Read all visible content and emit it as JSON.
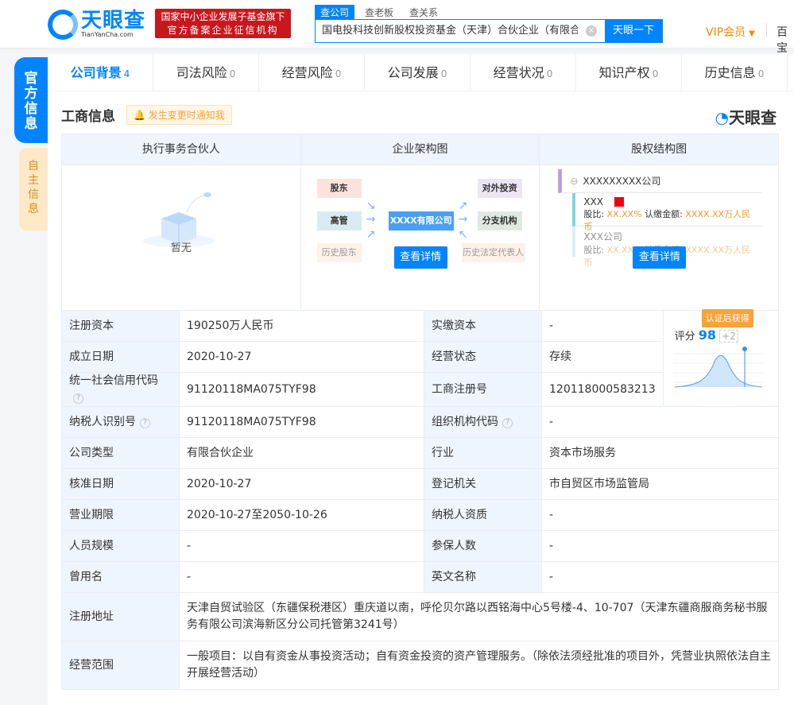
{
  "header": {
    "logo_cn": "天眼查",
    "logo_en": "TianYanCha.com",
    "badge_line1": "国家中小企业发展子基金旗下",
    "badge_line2": "官方备案企业征信机构",
    "search_tabs": [
      "查公司",
      "查老板",
      "查关系"
    ],
    "search_value": "国电投科技创新股权投资基金（天津）合伙企业（有限合伙）",
    "search_button": "天眼一下",
    "vip": "VIP会员",
    "more": "百宝"
  },
  "side": {
    "official": "官方信息",
    "self": "自主信息"
  },
  "tabs": [
    {
      "label": "公司背景",
      "count": "4"
    },
    {
      "label": "司法风险",
      "count": "0"
    },
    {
      "label": "经营风险",
      "count": "0"
    },
    {
      "label": "公司发展",
      "count": "0"
    },
    {
      "label": "经营状况",
      "count": "0"
    },
    {
      "label": "知识产权",
      "count": "0"
    },
    {
      "label": "历史信息",
      "count": "0"
    }
  ],
  "section": {
    "title": "工商信息",
    "notify": "发生变更时通知我",
    "watermark": "天眼查"
  },
  "cards": {
    "partner": {
      "title": "执行事务合伙人",
      "empty": "暂无"
    },
    "org": {
      "title": "企业架构图",
      "center": "XXXX有限公司",
      "left": [
        "股东",
        "高管",
        "历史股东"
      ],
      "right": [
        "对外投资",
        "分支机构",
        "历史法定代表人"
      ],
      "button": "查看详情"
    },
    "equity": {
      "title": "股权结构图",
      "root": "XXXXXXXXX公司",
      "n1": "XXX",
      "n2": "XXX公司",
      "ratio_label": "股比:",
      "ratio": "XX.XX%",
      "amount_label": "认缴金额:",
      "amount": "XXXX.XX万人民币",
      "button": "查看详情"
    }
  },
  "info": {
    "reg_capital": {
      "label": "注册资本",
      "value": "190250万人民币"
    },
    "paid_capital": {
      "label": "实缴资本",
      "value": "-"
    },
    "found_date": {
      "label": "成立日期",
      "value": "2020-10-27"
    },
    "status": {
      "label": "经营状态",
      "value": "存续"
    },
    "credit_code": {
      "label": "统一社会信用代码",
      "value": "91120118MA075TYF98"
    },
    "reg_no": {
      "label": "工商注册号",
      "value": "120118000583213"
    },
    "tax_id": {
      "label": "纳税人识别号",
      "value": "91120118MA075TYF98"
    },
    "org_code": {
      "label": "组织机构代码",
      "value": "-"
    },
    "type": {
      "label": "公司类型",
      "value": "有限合伙企业"
    },
    "industry": {
      "label": "行业",
      "value": "资本市场服务"
    },
    "approve_date": {
      "label": "核准日期",
      "value": "2020-10-27"
    },
    "authority": {
      "label": "登记机关",
      "value": "市自贸区市场监管局"
    },
    "term": {
      "label": "营业期限",
      "value": "2020-10-27至2050-10-26"
    },
    "taxpayer": {
      "label": "纳税人资质",
      "value": "-"
    },
    "staff": {
      "label": "人员规模",
      "value": "-"
    },
    "insured": {
      "label": "参保人数",
      "value": "-"
    },
    "former": {
      "label": "曾用名",
      "value": "-"
    },
    "en_name": {
      "label": "英文名称",
      "value": "-"
    },
    "address": {
      "label": "注册地址",
      "value": "天津自贸试验区（东疆保税港区）重庆道以南，呼伦贝尔路以西铭海中心5号楼-4、10-707（天津东疆商服商务秘书服务有限公司滨海新区分公司托管第3241号）"
    },
    "scope": {
      "label": "经营范围",
      "value": "一般项目：以自有资金从事投资活动；自有资金投资的资产管理服务。（除依法须经批准的项目外，凭营业执照依法自主开展经营活动）"
    }
  },
  "score": {
    "tag": "认证后获得",
    "label": "评分",
    "value": "98",
    "bonus": "+2",
    "accent": "#0084ff"
  }
}
